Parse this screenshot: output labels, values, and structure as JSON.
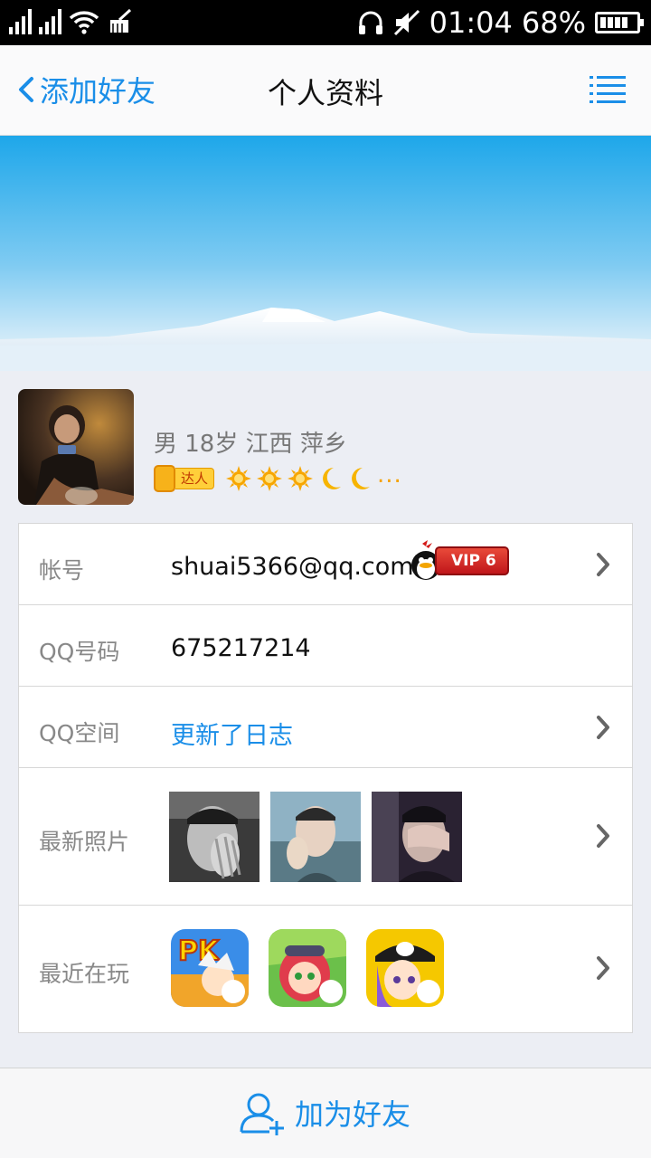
{
  "status_bar": {
    "time": "01:04",
    "battery": "68%",
    "icons": [
      "signal-icon",
      "signal-icon",
      "wifi-icon",
      "clean-icon",
      "headphone-icon",
      "mute-icon",
      "battery-icon"
    ]
  },
  "nav": {
    "back_label": "添加好友",
    "title": "个人资料",
    "menu_icon": "menu-icon"
  },
  "profile": {
    "basic_info": "男 18岁 江西 萍乡",
    "daren_label": "达人",
    "level_icons": [
      "sun-icon",
      "sun-icon",
      "sun-icon",
      "moon-icon",
      "moon-icon"
    ],
    "level_more": "..."
  },
  "rows": {
    "account": {
      "label": "帐号",
      "value": "shuai5366@qq.com",
      "vip": "VIP 6"
    },
    "qq_number": {
      "label": "QQ号码",
      "value": "675217214"
    },
    "qzone": {
      "label": "QQ空间",
      "value": "更新了日志"
    },
    "photos": {
      "label": "最新照片"
    },
    "games": {
      "label": "最近在玩",
      "pk_label": "PK"
    }
  },
  "bottom": {
    "add_friend": "加为好友"
  },
  "colors": {
    "accent": "#1a8ee8",
    "vip_red": "#d42a20",
    "background": "#eceef4"
  }
}
